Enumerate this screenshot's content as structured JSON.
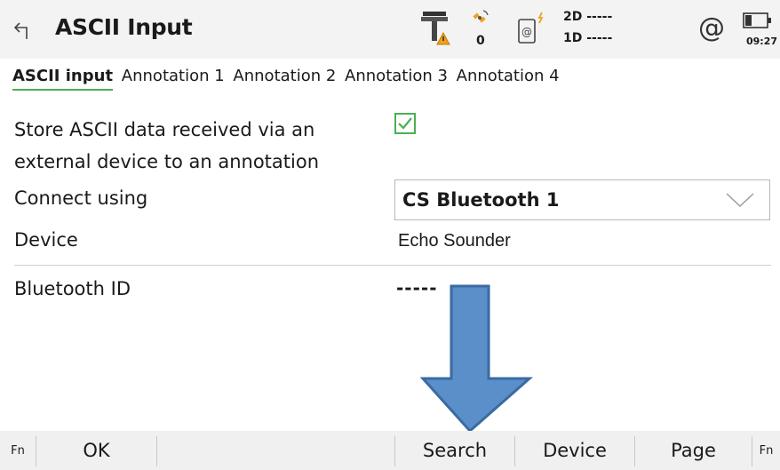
{
  "header": {
    "title": "ASCII Input",
    "status_2d": "2D -----",
    "status_1d": "1D -----",
    "satellite_count": "0",
    "at_symbol": "@",
    "time": "09:27",
    "icons": [
      "back-arrow-icon",
      "gnss-antenna-warning-icon",
      "satellite-icon",
      "device-connection-icon",
      "at-icon",
      "battery-icon"
    ]
  },
  "tabs": [
    {
      "label": "ASCII input",
      "active": true
    },
    {
      "label": "Annotation 1",
      "active": false
    },
    {
      "label": "Annotation 2",
      "active": false
    },
    {
      "label": "Annotation 3",
      "active": false
    },
    {
      "label": "Annotation 4",
      "active": false
    }
  ],
  "form": {
    "store_label_line1": "Store ASCII data received via an",
    "store_label_line2": "external device to an annotation",
    "store_checked": true,
    "connect_label": "Connect using",
    "connect_value": "CS Bluetooth 1",
    "device_label": "Device",
    "device_value": "Echo Sounder",
    "bluetooth_label": "Bluetooth ID",
    "bluetooth_value": "-----"
  },
  "softkeys": {
    "fn_left": "Fn",
    "ok": "OK",
    "search": "Search",
    "device": "Device",
    "page": "Page",
    "fn_right": "Fn"
  },
  "colors": {
    "accent_green": "#4caf50",
    "arrow_fill": "#5b8fc9",
    "arrow_stroke": "#3a6aa2",
    "warning_orange": "#f0a020"
  }
}
